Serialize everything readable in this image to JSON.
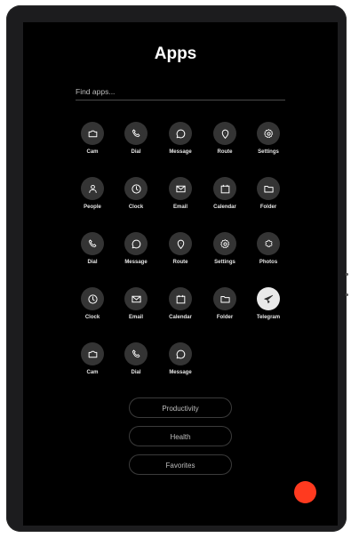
{
  "header": {
    "title": "Apps"
  },
  "search": {
    "placeholder": "Find apps..."
  },
  "apps": [
    {
      "label": "Cam",
      "icon": "camera-icon"
    },
    {
      "label": "Dial",
      "icon": "phone-icon"
    },
    {
      "label": "Message",
      "icon": "chat-icon"
    },
    {
      "label": "Route",
      "icon": "map-pin-icon"
    },
    {
      "label": "Settings",
      "icon": "gear-icon"
    },
    {
      "label": "People",
      "icon": "person-icon"
    },
    {
      "label": "Clock",
      "icon": "clock-icon"
    },
    {
      "label": "Email",
      "icon": "mail-icon"
    },
    {
      "label": "Calendar",
      "icon": "calendar-icon"
    },
    {
      "label": "Folder",
      "icon": "folder-icon"
    },
    {
      "label": "Dial",
      "icon": "phone-icon"
    },
    {
      "label": "Message",
      "icon": "chat-icon"
    },
    {
      "label": "Route",
      "icon": "map-pin-icon"
    },
    {
      "label": "Settings",
      "icon": "gear-icon"
    },
    {
      "label": "Photos",
      "icon": "flower-icon"
    },
    {
      "label": "Clock",
      "icon": "clock-icon"
    },
    {
      "label": "Email",
      "icon": "mail-icon"
    },
    {
      "label": "Calendar",
      "icon": "calendar-icon"
    },
    {
      "label": "Folder",
      "icon": "folder-icon"
    },
    {
      "label": "Telegram",
      "icon": "send-icon"
    },
    {
      "label": "Cam",
      "icon": "camera-icon"
    },
    {
      "label": "Dial",
      "icon": "phone-icon"
    },
    {
      "label": "Message",
      "icon": "chat-icon"
    }
  ],
  "categories": [
    "Productivity",
    "Health",
    "Favorites"
  ],
  "colors": {
    "accent": "#ff3a1f",
    "background": "#000000",
    "icon_bg": "#343434"
  }
}
